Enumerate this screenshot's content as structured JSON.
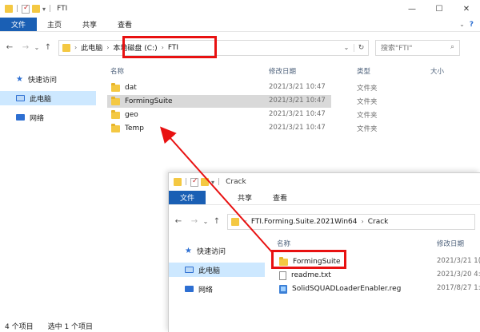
{
  "win1": {
    "title": "FTI",
    "ribbon": [
      "文件",
      "主页",
      "共享",
      "查看"
    ],
    "breadcrumb": {
      "root": "此电脑",
      "drive": "本地磁盘 (C:)",
      "folder": "FTI"
    },
    "search_placeholder": "搜索\"FTI\"",
    "nav": [
      {
        "label": "快速访问",
        "icon": "star-icon"
      },
      {
        "label": "此电脑",
        "icon": "computer-icon"
      },
      {
        "label": "网络",
        "icon": "network-icon"
      }
    ],
    "columns": {
      "name": "名称",
      "date": "修改日期",
      "type": "类型",
      "size": "大小"
    },
    "rows": [
      {
        "name": "dat",
        "date": "2021/3/21 10:47",
        "type": "文件夹"
      },
      {
        "name": "FormingSuite",
        "date": "2021/3/21 10:47",
        "type": "文件夹"
      },
      {
        "name": "geo",
        "date": "2021/3/21 10:47",
        "type": "文件夹"
      },
      {
        "name": "Temp",
        "date": "2021/3/21 10:47",
        "type": "文件夹"
      }
    ],
    "status": {
      "count": "4 个项目",
      "selected": "选中 1 个项目"
    }
  },
  "win2": {
    "title": "Crack",
    "ribbon": [
      "文件",
      "共享",
      "查看"
    ],
    "breadcrumb": {
      "prefix": "«",
      "folder": "FTI.Forming.Suite.2021Win64",
      "sub": "Crack"
    },
    "nav": [
      {
        "label": "快速访问",
        "icon": "star-icon"
      },
      {
        "label": "此电脑",
        "icon": "computer-icon"
      },
      {
        "label": "网络",
        "icon": "network-icon"
      }
    ],
    "columns": {
      "name": "名称",
      "date": "修改日期"
    },
    "rows": [
      {
        "name": "FormingSuite",
        "date": "2021/3/21 1(",
        "icon": "folder-icon"
      },
      {
        "name": "readme.txt",
        "date": "2021/3/20 4:",
        "icon": "text-file-icon"
      },
      {
        "name": "SolidSQUADLoaderEnabler.reg",
        "date": "2017/8/27 1:",
        "icon": "reg-file-icon"
      }
    ]
  },
  "colors": {
    "accent": "#1a5fb4",
    "highlight": "#e81111",
    "selection": "#cde8ff"
  }
}
